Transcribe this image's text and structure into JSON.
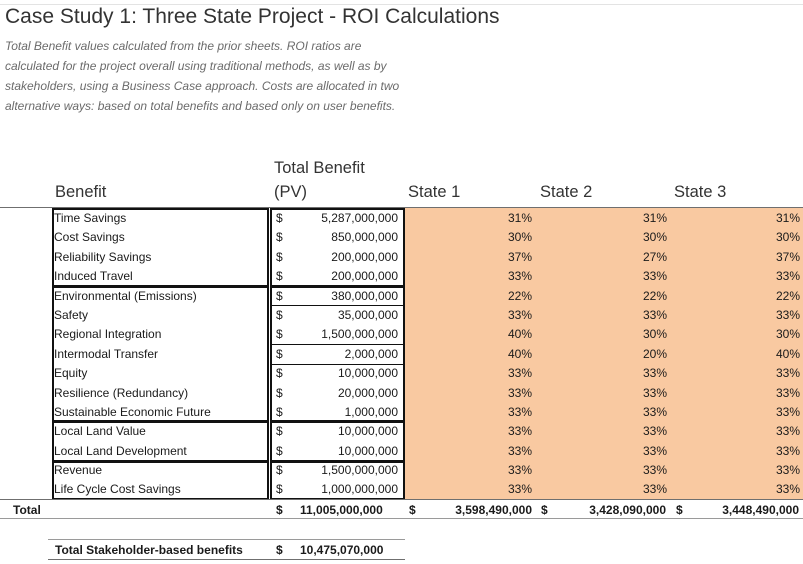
{
  "title": "Case Study 1: Three State Project - ROI Calculations",
  "description": "Total Benefit values calculated from the prior sheets.  ROI ratios are calculated for the project overall using traditional methods, as well as by stakeholders, using a Business Case approach.  Costs are allocated in two alternative ways: based on total benefits and based only on user benefits.",
  "headers": {
    "benefit": "Benefit",
    "total_benefit_line1": "Total Benefit",
    "total_benefit_line2": "(PV)",
    "state1": "State 1",
    "state2": "State 2",
    "state3": "State 3"
  },
  "rows": [
    {
      "name": "Time Savings",
      "dollar": "$",
      "amount": "5,287,000,000",
      "s1": "31%",
      "s2": "31%",
      "s3": "31%"
    },
    {
      "name": "Cost Savings",
      "dollar": "$",
      "amount": "850,000,000",
      "s1": "30%",
      "s2": "30%",
      "s3": "30%"
    },
    {
      "name": "Reliability Savings",
      "dollar": "$",
      "amount": "200,000,000",
      "s1": "37%",
      "s2": "27%",
      "s3": "37%"
    },
    {
      "name": "Induced Travel",
      "dollar": "$",
      "amount": "200,000,000",
      "s1": "33%",
      "s2": "33%",
      "s3": "33%"
    },
    {
      "name": "Environmental (Emissions)",
      "dollar": "$",
      "amount": "380,000,000",
      "s1": "22%",
      "s2": "22%",
      "s3": "22%"
    },
    {
      "name": "Safety",
      "dollar": "$",
      "amount": "35,000,000",
      "s1": "33%",
      "s2": "33%",
      "s3": "33%"
    },
    {
      "name": "Regional Integration",
      "dollar": "$",
      "amount": "1,500,000,000",
      "s1": "40%",
      "s2": "30%",
      "s3": "30%"
    },
    {
      "name": "Intermodal Transfer",
      "dollar": "$",
      "amount": "2,000,000",
      "s1": "40%",
      "s2": "20%",
      "s3": "40%"
    },
    {
      "name": "Equity",
      "dollar": "$",
      "amount": "10,000,000",
      "s1": "33%",
      "s2": "33%",
      "s3": "33%"
    },
    {
      "name": "Resilience (Redundancy)",
      "dollar": "$",
      "amount": "20,000,000",
      "s1": "33%",
      "s2": "33%",
      "s3": "33%"
    },
    {
      "name": "Sustainable Economic Future",
      "dollar": "$",
      "amount": "1,000,000",
      "s1": "33%",
      "s2": "33%",
      "s3": "33%"
    },
    {
      "name": "Local Land Value",
      "dollar": "$",
      "amount": "10,000,000",
      "s1": "33%",
      "s2": "33%",
      "s3": "33%"
    },
    {
      "name": "Local Land Development",
      "dollar": "$",
      "amount": "10,000,000",
      "s1": "33%",
      "s2": "33%",
      "s3": "33%"
    },
    {
      "name": "Revenue",
      "dollar": "$",
      "amount": "1,500,000,000",
      "s1": "33%",
      "s2": "33%",
      "s3": "33%"
    },
    {
      "name": "Life Cycle Cost Savings",
      "dollar": "$",
      "amount": "1,000,000,000",
      "s1": "33%",
      "s2": "33%",
      "s3": "33%"
    }
  ],
  "total": {
    "label": "Total",
    "dollar": "$",
    "amount": "11,005,000,000",
    "s1": "3,598,490,000",
    "s2": "3,428,090,000",
    "s3": "3,448,490,000"
  },
  "stakeholder": {
    "label": "Total Stakeholder-based benefits",
    "dollar": "$",
    "amount": "10,475,070,000"
  },
  "colors": {
    "shade": "#f9c9a1",
    "border": "#111111"
  }
}
